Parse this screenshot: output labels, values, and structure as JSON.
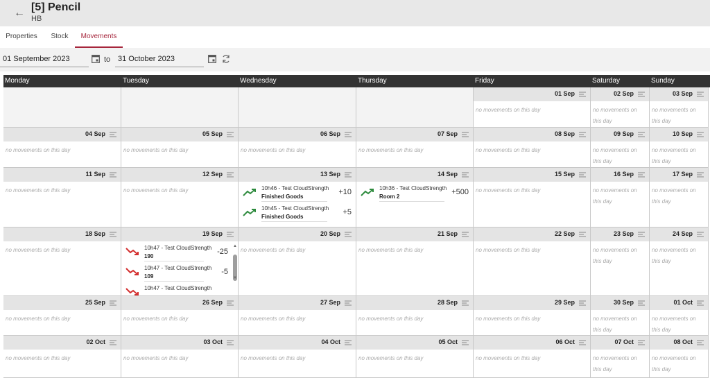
{
  "header": {
    "title": "[5] Pencil",
    "subtitle": "HB"
  },
  "tabs": [
    {
      "label": "Properties",
      "active": false
    },
    {
      "label": "Stock",
      "active": false
    },
    {
      "label": "Movements",
      "active": true
    }
  ],
  "filters": {
    "from": "01 September 2023",
    "to_label": "to",
    "to": "31 October 2023"
  },
  "days": [
    "Monday",
    "Tuesday",
    "Wednesday",
    "Thursday",
    "Friday",
    "Saturday",
    "Sunday"
  ],
  "no_movements_text": "no movements on this day",
  "colors": {
    "accent": "#a6263c",
    "up": "#2e8b3e",
    "down": "#d32f2f",
    "header": "#333333"
  },
  "weeks": [
    [
      "",
      "",
      "",
      "",
      "01 Sep",
      "02 Sep",
      "03 Sep"
    ],
    [
      "04 Sep",
      "05 Sep",
      "06 Sep",
      "07 Sep",
      "08 Sep",
      "09 Sep",
      "10 Sep"
    ],
    [
      "11 Sep",
      "12 Sep",
      "13 Sep",
      "14 Sep",
      "15 Sep",
      "16 Sep",
      "17 Sep"
    ],
    [
      "18 Sep",
      "19 Sep",
      "20 Sep",
      "21 Sep",
      "22 Sep",
      "23 Sep",
      "24 Sep"
    ],
    [
      "25 Sep",
      "26 Sep",
      "27 Sep",
      "28 Sep",
      "29 Sep",
      "30 Sep",
      "01 Oct"
    ],
    [
      "02 Oct",
      "03 Oct",
      "04 Oct",
      "05 Oct",
      "06 Oct",
      "07 Oct",
      "08 Oct"
    ]
  ],
  "movements": {
    "13 Sep": [
      {
        "title": "10h46 - Test CloudStrength",
        "sub": "Finished Goods",
        "qty": "+10",
        "dir": "up"
      },
      {
        "title": "10h45 - Test CloudStrength",
        "sub": "Finished Goods",
        "qty": "+5",
        "dir": "up"
      }
    ],
    "14 Sep": [
      {
        "title": "10h36 - Test CloudStrength",
        "sub": "Room 2",
        "qty": "+500",
        "dir": "up"
      }
    ],
    "19 Sep": [
      {
        "title": "10h47 - Test CloudStrength",
        "sub": "190",
        "qty": "-25",
        "dir": "down"
      },
      {
        "title": "10h47 - Test CloudStrength",
        "sub": "109",
        "qty": "-5",
        "dir": "down"
      },
      {
        "title": "10h47 - Test CloudStrength",
        "sub": "",
        "qty": "",
        "dir": "down"
      }
    ]
  }
}
